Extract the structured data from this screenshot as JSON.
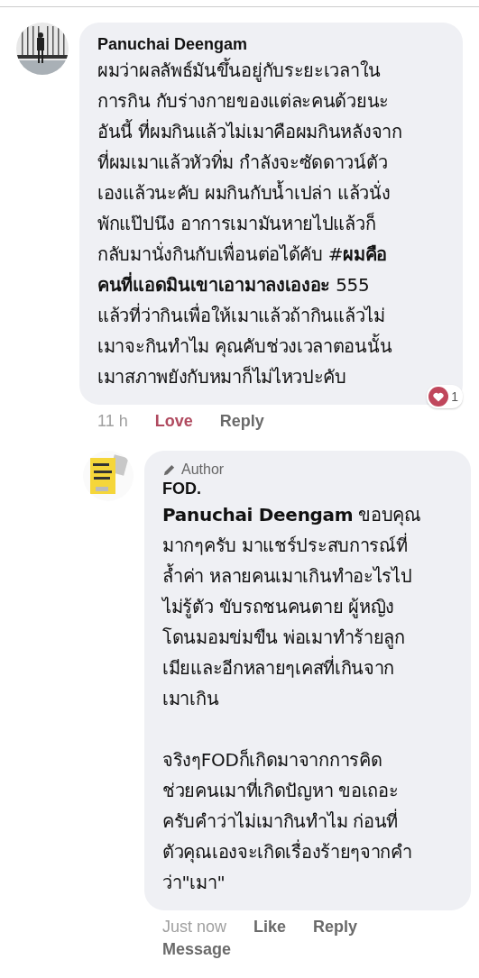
{
  "comments": [
    {
      "author": "Panuchai Deengam",
      "lines": [
        "ผมว่าผลลัพธ์มันขึ้นอยู่กับระยะเวลาใน",
        "การกิน กับร่างกายของแต่ละคนด้วยนะ",
        "อันนี้ ที่ผมกินแล้วไม่เมาคือผมกินหลังจาก",
        "ที่ผมเมาแล้วหัวทิ่ม กำลังจะซัดดาวน์ตัว",
        "เองแล้วนะคับ ผมกินกับน้ำเปล่า แล้วนั่ง",
        "พักแป๊ปนึง อาการเมามันหายไปแล้วก็",
        "กลับมานั่งกินกับเพื่อนต่อได้คับ #**ผมคือ**",
        "**คนที่แอดมินเขาเอามาลงเองอะ** 555",
        "แล้วที่ว่ากินเพื่อให้เมาแล้วถ้ากินแล้วไม่",
        "เมาจะกินทำไม คุณคับช่วงเวลาตอนนั้น",
        "เมาสภาพยังกับหมาก็ไม่ไหวปะคับ"
      ],
      "time": "11 h",
      "actions": [
        {
          "label": "Love",
          "selected": true
        },
        {
          "label": "Reply",
          "selected": false
        }
      ],
      "reaction_count": "1"
    },
    {
      "author": "FOD.",
      "badge": "Author",
      "paragraphs": [
        [
          "**Panuchai Deengam** ขอบคุณ",
          "มากๆครับ มาแชร์ประสบการณ์ที่",
          "ล้ำค่า หลายคนเมาเกินทำอะไรไป",
          "ไม่รู้ตัว ขับรถชนคนตาย ผู้หญิง",
          "โดนมอมข่มขืน พ่อเมาทำร้ายลูก",
          "เมียและอีกหลายๆเคสที่เกินจาก",
          "เมาเกิน"
        ],
        [
          "จริงๆFODก็เกิดมาจากการคิด",
          "ช่วยคนเมาที่เกิดปัญหา ขอเถอะ",
          "ครับคำว่าไม่เมากินทำไม ก่อนที่",
          "ตัวคุณเองจะเกิดเรื่องร้ายๆจากคำ",
          "ว่า\"เมา\""
        ]
      ],
      "time": "Just now",
      "actions": [
        {
          "label": "Like",
          "selected": false
        },
        {
          "label": "Reply",
          "selected": false
        },
        {
          "label": "Message",
          "selected": false
        }
      ]
    }
  ]
}
